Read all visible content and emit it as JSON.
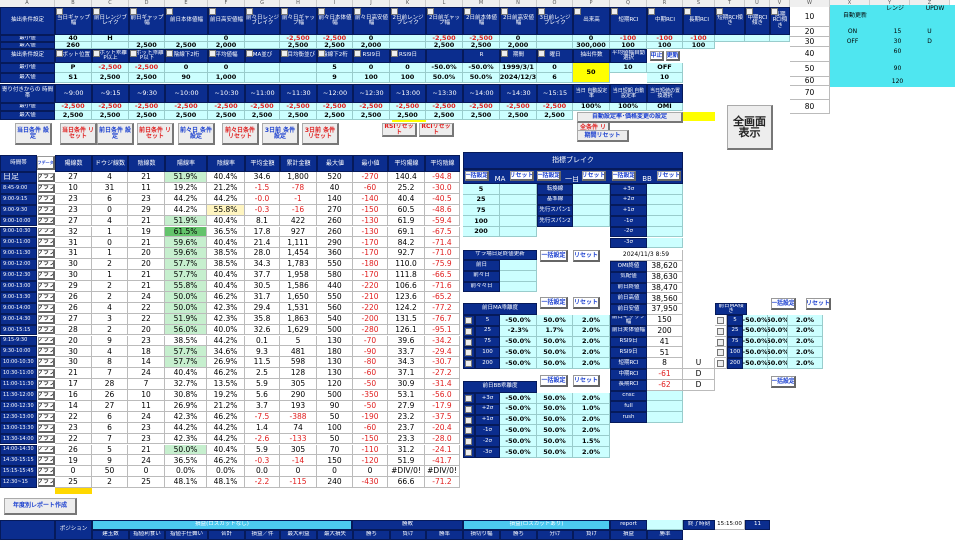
{
  "col_letters": [
    "A",
    "B",
    "C",
    "D",
    "E",
    "F",
    "G",
    "H",
    "I",
    "J",
    "K",
    "L",
    "M",
    "N",
    "O",
    "P",
    "Q",
    "R",
    "S",
    "T",
    "U",
    "V",
    "W",
    "X",
    "Y",
    "Z"
  ],
  "filter1": {
    "title": "抽出条件設定",
    "min_label": "最小値",
    "max_label": "最大値",
    "headers": [
      "当日ギャップ幅",
      "前日レンジブレイク",
      "前日ギャップ幅",
      "前日本体値幅",
      "前日高安値幅",
      "前々日レンジブレイク",
      "前々日ギャップ幅",
      "前々日本体値幅",
      "前々日高安値幅",
      "2日前レンジブレイク",
      "2日前ギャップ幅",
      "2日前本体値幅",
      "2日前高安値幅",
      "3日前レンジブレイク",
      "出来高",
      "短期RCI",
      "中期RCI",
      "長期RCI",
      "短期RCI傾き",
      "中期RCI傾き",
      "長期RCI傾き"
    ],
    "min": [
      "40",
      "H",
      "",
      "",
      "0",
      "",
      "-2,500",
      "-2,500",
      "0",
      "",
      "-2,500",
      "-2,500",
      "0",
      "",
      "0",
      "-100",
      "-100",
      "-100",
      "",
      "",
      ""
    ],
    "max": [
      "260",
      "",
      "2,500",
      "2,500",
      "2,000",
      "",
      "2,500",
      "2,500",
      "2,000",
      "",
      "2,500",
      "2,500",
      "2,000",
      "",
      "300,000",
      "100",
      "100",
      "100",
      "",
      "",
      ""
    ]
  },
  "filter2": {
    "title": "抽出条件設定",
    "min_label": "最小値",
    "max_label": "最大値",
    "headers": [
      "ピボット位置",
      "ピボット乖離P以上",
      "ピボット乖離P以下",
      "陰線下2桁",
      "平均値幅",
      "MA並び",
      "一目均衡並び",
      "陰線下2桁",
      "RSI9日",
      "RSI9日",
      "",
      "R",
      "期間",
      "曜日",
      "抽出件数",
      "平均値幅自動選択"
    ],
    "min": [
      "P",
      "-2,500",
      "-2,500",
      "0",
      "0",
      "",
      "",
      "5",
      "0",
      "0",
      "-50.0%",
      "-50.0%",
      "1999/3/1",
      "0",
      "50",
      "10"
    ],
    "max": [
      "S1",
      "2,500",
      "2,500",
      "90",
      "1,000",
      "",
      "",
      "9",
      "100",
      "100",
      "50.0%",
      "50.0%",
      "2024/12/3",
      "6",
      "",
      ""
    ],
    "stop_label": "中止",
    "update_label": "更新",
    "auto_value": "OFF",
    "auto_max": "10"
  },
  "time_filter": {
    "title": "寄り付きからの 時間帯",
    "min_label": "最小値",
    "max_label": "最大値",
    "headers": [
      "~9:00",
      "~9:15",
      "~9:30",
      "~10:00",
      "~10:30",
      "~11:00",
      "~11:30",
      "~12:00",
      "~12:30",
      "~13:00",
      "~13:30",
      "~14:00",
      "~14:30",
      "~15:15",
      "当日 自動設定率",
      "当日短期 自動設定率",
      "当日短値の置 換選択"
    ],
    "min": [
      "-2,500",
      "-2,500",
      "-2,500",
      "-2,500",
      "-2,500",
      "-2,500",
      "-2,500",
      "-2,500",
      "-2,500",
      "-2,500",
      "-2,500",
      "-2,500",
      "-2,500",
      "-2,500",
      "100%",
      "100%",
      "OMI"
    ],
    "max": [
      "2,500",
      "2,500",
      "2,500",
      "2,500",
      "2,500",
      "2,500",
      "2,500",
      "2,500",
      "2,500",
      "2,500",
      "2,500",
      "2,500",
      "2,500",
      "2,500",
      "",
      "",
      ""
    ]
  },
  "buttons": {
    "set_today": "当日条件 設定",
    "reset_today": "当日条件 リセット",
    "set_prev": "前日条件 設定",
    "reset_prev": "前日条件 リセット",
    "set_prev2": "前々日 条件設定",
    "reset_prev2": "前々日条件 リセット",
    "set_3d": "3日前 条件設定",
    "reset_3d": "3日前 条件リセット",
    "rsi_reset": "RSIリセット",
    "rci_reset": "RCIリセット",
    "all_reset": "全条件 リセット",
    "auto_rate": "自動設定率･価格変更の設定",
    "period_reset": "期間リセット",
    "fullscreen": "全画面 表示",
    "yearly_report": "年度別レポート作成"
  },
  "right_list": {
    "values": [
      "10",
      "20",
      "30",
      "40",
      "50",
      "60",
      "70",
      "80"
    ],
    "auto_update": "自動更新",
    "range": "レンジ",
    "updw": "UPDW",
    "on": "ON",
    "off": "OFF",
    "ranges": [
      "15",
      "30",
      "60",
      "90",
      "120"
    ],
    "u": "U",
    "d": "D"
  },
  "main_table": {
    "headers": [
      "時間帯",
      "グラフデータ取得",
      "陽線数",
      "ドウジ線数",
      "陰線数",
      "陽線率",
      "陰線率",
      "平均金額",
      "累計金額",
      "最大値",
      "最小値",
      "平均陽線",
      "平均陰線"
    ],
    "graph_label": "グラフ",
    "rows": [
      [
        "日足",
        "27",
        "4",
        "21",
        "51.9%",
        "40.4%",
        "34.6",
        "1,800",
        "520",
        "-270",
        "140.4",
        "-94.8"
      ],
      [
        "8:45-9:00",
        "10",
        "31",
        "11",
        "19.2%",
        "21.2%",
        "-1.5",
        "-78",
        "40",
        "-60",
        "25.2",
        "-30.0"
      ],
      [
        "9:00-9:15",
        "23",
        "6",
        "23",
        "44.2%",
        "44.2%",
        "-0.0",
        "-1",
        "140",
        "-140",
        "40.4",
        "-40.5"
      ],
      [
        "9:00-9:30",
        "23",
        "0",
        "29",
        "44.2%",
        "55.8%",
        "-0.3",
        "-16",
        "270",
        "-150",
        "60.5",
        "-48.6"
      ],
      [
        "9:00-10:00",
        "27",
        "4",
        "21",
        "51.9%",
        "40.4%",
        "8.1",
        "422",
        "260",
        "-130",
        "61.9",
        "-59.4"
      ],
      [
        "9:00-10:30",
        "32",
        "1",
        "19",
        "61.5%",
        "36.5%",
        "17.8",
        "927",
        "260",
        "-130",
        "69.1",
        "-67.5"
      ],
      [
        "9:00-11:00",
        "31",
        "0",
        "21",
        "59.6%",
        "40.4%",
        "21.4",
        "1,111",
        "290",
        "-170",
        "84.2",
        "-71.4"
      ],
      [
        "9:00-11:30",
        "31",
        "1",
        "20",
        "59.6%",
        "38.5%",
        "28.0",
        "1,454",
        "360",
        "-170",
        "92.7",
        "-71.0"
      ],
      [
        "9:00-12:00",
        "30",
        "2",
        "20",
        "57.7%",
        "38.5%",
        "34.3",
        "1,783",
        "550",
        "-180",
        "110.0",
        "-75.9"
      ],
      [
        "9:00-12:30",
        "30",
        "1",
        "21",
        "57.7%",
        "40.4%",
        "37.7",
        "1,958",
        "580",
        "-170",
        "111.8",
        "-66.5"
      ],
      [
        "9:00-13:00",
        "29",
        "2",
        "21",
        "55.8%",
        "40.4%",
        "30.5",
        "1,586",
        "440",
        "-220",
        "106.6",
        "-71.6"
      ],
      [
        "9:00-13:30",
        "26",
        "2",
        "24",
        "50.0%",
        "46.2%",
        "31.7",
        "1,650",
        "550",
        "-210",
        "123.6",
        "-65.2"
      ],
      [
        "9:00-14:00",
        "26",
        "4",
        "22",
        "50.0%",
        "42.3%",
        "29.4",
        "1,531",
        "560",
        "-220",
        "124.2",
        "-77.2"
      ],
      [
        "9:00-14:30",
        "27",
        "3",
        "22",
        "51.9%",
        "42.3%",
        "35.8",
        "1,863",
        "540",
        "-200",
        "131.5",
        "-76.7"
      ],
      [
        "9:00-15:15",
        "28",
        "2",
        "20",
        "56.0%",
        "40.0%",
        "32.6",
        "1,629",
        "500",
        "-280",
        "126.1",
        "-95.1"
      ],
      [
        "9:15-9:30",
        "20",
        "9",
        "23",
        "38.5%",
        "44.2%",
        "0.1",
        "5",
        "130",
        "-70",
        "39.6",
        "-34.2"
      ],
      [
        "9:30-10:00",
        "30",
        "4",
        "18",
        "57.7%",
        "34.6%",
        "9.3",
        "481",
        "180",
        "-90",
        "33.7",
        "-29.4"
      ],
      [
        "10:00-10:30",
        "30",
        "8",
        "14",
        "57.7%",
        "26.9%",
        "11.5",
        "598",
        "130",
        "-80",
        "34.3",
        "-30.7"
      ],
      [
        "10:30-11:00",
        "21",
        "7",
        "24",
        "40.4%",
        "46.2%",
        "2.5",
        "128",
        "130",
        "-60",
        "37.1",
        "-27.2"
      ],
      [
        "11:00-11:30",
        "17",
        "28",
        "7",
        "32.7%",
        "13.5%",
        "5.9",
        "305",
        "120",
        "-50",
        "30.9",
        "-31.4"
      ],
      [
        "11:30-12:00",
        "16",
        "26",
        "10",
        "30.8%",
        "19.2%",
        "5.6",
        "290",
        "500",
        "-350",
        "53.1",
        "-56.0"
      ],
      [
        "12:00-12:30",
        "14",
        "27",
        "11",
        "26.9%",
        "21.2%",
        "3.7",
        "193",
        "90",
        "-50",
        "27.9",
        "-17.9"
      ],
      [
        "12:30-13:00",
        "22",
        "6",
        "24",
        "42.3%",
        "46.2%",
        "-7.5",
        "-388",
        "50",
        "-190",
        "23.2",
        "-37.5"
      ],
      [
        "13:00-13:30",
        "23",
        "6",
        "23",
        "44.2%",
        "44.2%",
        "1.4",
        "74",
        "100",
        "-60",
        "23.7",
        "-20.4"
      ],
      [
        "13:30-14:00",
        "22",
        "7",
        "23",
        "42.3%",
        "44.2%",
        "-2.6",
        "-133",
        "50",
        "-150",
        "23.3",
        "-28.0"
      ],
      [
        "14:00-14:30",
        "26",
        "5",
        "21",
        "50.0%",
        "40.4%",
        "5.9",
        "305",
        "70",
        "-110",
        "31.2",
        "-24.1"
      ],
      [
        "14:30-15:15",
        "19",
        "9",
        "24",
        "36.5%",
        "46.2%",
        "-0.3",
        "-14",
        "150",
        "-120",
        "51.9",
        "-41.7"
      ],
      [
        "15:15-15:45",
        "0",
        "50",
        "0",
        "0.0%",
        "0.0%",
        "0.0",
        "0",
        "0",
        "0",
        "#DIV/0!",
        "#DIV/0!"
      ],
      [
        "12:30~15",
        "25",
        "2",
        "25",
        "48.1%",
        "48.1%",
        "-2.2",
        "-115",
        "240",
        "-430",
        "66.6",
        "-71.2"
      ]
    ]
  },
  "indicator_break": {
    "title": "指標ブレイク",
    "bulk_label": "一括設定",
    "reset_label": "リセット",
    "ma_label": "MA",
    "ichimoku_label": "一目",
    "bb_label": "BB",
    "ma_rows": [
      "5",
      "25",
      "75",
      "100",
      "200"
    ],
    "ichimoku_rows": [
      "転換線",
      "基準線",
      "先行スパン1",
      "先行スパン2"
    ],
    "bb_rows": [
      "+3σ",
      "+2σ",
      "+1σ",
      "-1σ",
      "-2σ",
      "-3σ"
    ]
  },
  "zaraba": {
    "title": "ザラ場日足終値更新",
    "rows": [
      "前日",
      "前々日",
      "前々々日"
    ]
  },
  "market": {
    "datetime": "2024/11/3 8:59",
    "rows": [
      [
        "OMI終値",
        "38,620"
      ],
      [
        "気配値",
        "38,630"
      ],
      [
        "前日終値",
        "38,470"
      ],
      [
        "前日高値",
        "38,560"
      ],
      [
        "前日安値",
        "37,950"
      ],
      [
        "前日ギャップ幅",
        "150"
      ],
      [
        "前日実体値幅",
        "200"
      ],
      [
        "RSI9日",
        "41"
      ],
      [
        "RSI9日",
        "51"
      ],
      [
        "短期RCI",
        "8"
      ],
      [
        "中期RCI",
        "-61"
      ],
      [
        "長期RCI",
        "-62"
      ],
      [
        "cnsc",
        ""
      ],
      [
        "full",
        ""
      ],
      [
        "rush",
        ""
      ]
    ],
    "ud": [
      "U",
      "D",
      "D"
    ]
  },
  "ma_dev": {
    "title": "前日MA乖離度",
    "rows": [
      [
        "5",
        "-50.0%",
        "50.0%",
        "2.0%"
      ],
      [
        "25",
        "-2.3%",
        "1.7%",
        "2.0%"
      ],
      [
        "75",
        "-50.0%",
        "50.0%",
        "2.0%"
      ],
      [
        "100",
        "-50.0%",
        "50.0%",
        "2.0%"
      ],
      [
        "200",
        "-50.0%",
        "50.0%",
        "2.0%"
      ]
    ]
  },
  "bb_dev": {
    "title": "前日BB乖離度",
    "rows": [
      [
        "+3σ",
        "-50.0%",
        "50.0%",
        "2.0%"
      ],
      [
        "+2σ",
        "-50.0%",
        "50.0%",
        "1.0%"
      ],
      [
        "+1σ",
        "-50.0%",
        "50.0%",
        "2.0%"
      ],
      [
        "-1σ",
        "-50.0%",
        "50.0%",
        "2.0%"
      ],
      [
        "-2σ",
        "-50.0%",
        "50.0%",
        "1.5%"
      ],
      [
        "-3σ",
        "-50.0%",
        "50.0%",
        "2.0%"
      ]
    ]
  },
  "ma_slope": {
    "title": "前日MA傾き",
    "rows": [
      [
        "5",
        "-50.0%",
        "50.0%",
        "2.0%"
      ],
      [
        "25",
        "-50.0%",
        "50.0%",
        "2.0%"
      ],
      [
        "75",
        "-50.0%",
        "50.0%",
        "2.0%"
      ],
      [
        "100",
        "-50.0%",
        "50.0%",
        "2.0%"
      ],
      [
        "200",
        "-50.0%",
        "50.0%",
        "2.0%"
      ]
    ]
  },
  "bottom": {
    "position": "ポジション",
    "pl_no_cut": "損益(ロスカットなし)",
    "win_loss": "勝敗",
    "pl_cut": "損益(ロスカットあり)",
    "report": "report",
    "end_time_label": "終了時刻",
    "end_time": "15:15:00",
    "end_num": "11",
    "subheaders": [
      "建玉数",
      "指値利食い",
      "指値手仕舞い",
      "合計",
      "損益／件",
      "最大利益",
      "最大損失",
      "勝ち",
      "負け",
      "勝率",
      "損切り幅",
      "勝ち",
      "分け",
      "負け",
      "損益",
      "勝率"
    ]
  },
  "colors": {
    "dark": "#0b2d8e",
    "cyan": "#ccffff",
    "green": "#c6efce",
    "yellow": "#ffff00"
  }
}
